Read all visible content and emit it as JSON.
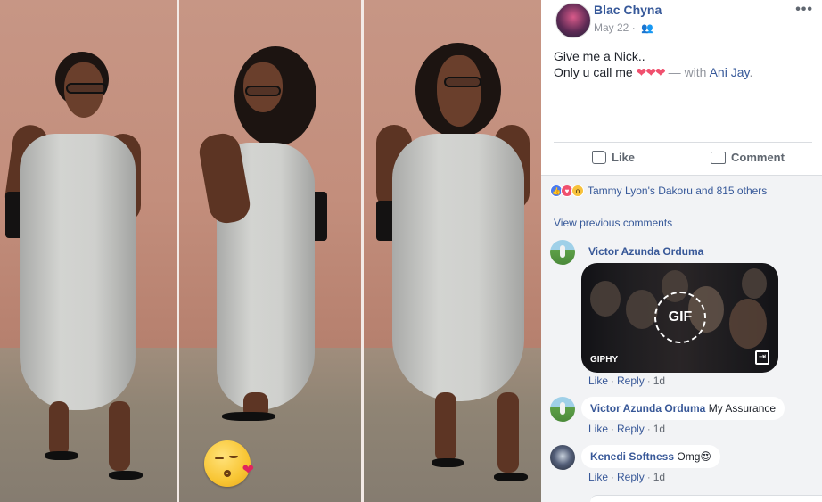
{
  "post": {
    "author": "Blac Chyna",
    "date": "May 22",
    "audience_icon": "friends-icon",
    "more_icon": "more-options-icon",
    "text_line1": "Give me a Nick..",
    "text_line2_prefix": "Only u call me",
    "hearts": "❤❤❤",
    "with_label": " — with ",
    "tagged": "Ani Jay",
    "tagged_suffix": "."
  },
  "actions": {
    "like": "Like",
    "comment": "Comment"
  },
  "reactions": {
    "icons": [
      "like-reaction-icon",
      "love-reaction-icon",
      "wow-reaction-icon"
    ],
    "summary": "Tammy Lyon's Dakoru and 815 others"
  },
  "comments_section": {
    "view_previous": "View previous comments",
    "items": [
      {
        "name": "Victor Azunda Orduma",
        "text": "",
        "gif_badge": "GIF",
        "gif_source": "GIPHY",
        "like": "Like",
        "reply": "Reply",
        "time": "1d"
      },
      {
        "name": "Victor Azunda Orduma",
        "text": "My Assurance",
        "like": "Like",
        "reply": "Reply",
        "time": "1d"
      },
      {
        "name": "Kenedi Softness",
        "text": "Omg😍",
        "like": "Like",
        "reply": "Reply",
        "time": "1d"
      }
    ]
  },
  "colors": {
    "link": "#365899",
    "heart": "#f0506e",
    "comments_bg": "#f2f3f5"
  }
}
